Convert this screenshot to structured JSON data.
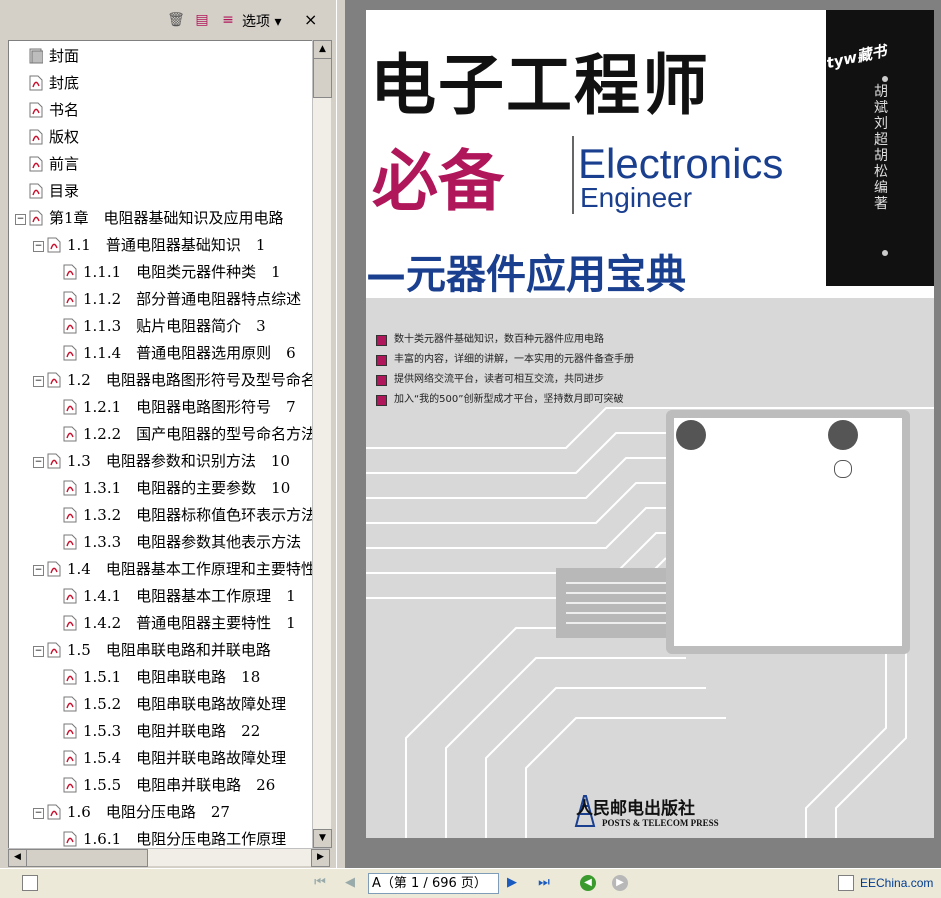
{
  "toolbar": {
    "options_label": "选项 ▾",
    "close_label": "×"
  },
  "bookmarks": [
    {
      "label": "封面",
      "level": 0,
      "expander": "",
      "icon": "page"
    },
    {
      "label": "封底",
      "level": 0,
      "expander": "",
      "icon": "pdf"
    },
    {
      "label": "书名",
      "level": 0,
      "expander": "",
      "icon": "pdf"
    },
    {
      "label": "版权",
      "level": 0,
      "expander": "",
      "icon": "pdf"
    },
    {
      "label": "前言",
      "level": 0,
      "expander": "",
      "icon": "pdf"
    },
    {
      "label": "目录",
      "level": 0,
      "expander": "",
      "icon": "pdf"
    },
    {
      "label": "第1章　电阻器基础知识及应用电路",
      "level": 0,
      "expander": "−",
      "icon": "pdf"
    },
    {
      "label": "1.1　普通电阻器基础知识　1",
      "level": 1,
      "expander": "−",
      "icon": "pdf"
    },
    {
      "label": "1.1.1　电阻类元器件种类　1",
      "level": 2,
      "expander": "",
      "icon": "pdf"
    },
    {
      "label": "1.1.2　部分普通电阻器特点综述",
      "level": 2,
      "expander": "",
      "icon": "pdf"
    },
    {
      "label": "1.1.3　贴片电阻器简介　3",
      "level": 2,
      "expander": "",
      "icon": "pdf"
    },
    {
      "label": "1.1.4　普通电阻器选用原则　6",
      "level": 2,
      "expander": "",
      "icon": "pdf"
    },
    {
      "label": "1.2　电阻器电路图形符号及型号命名",
      "level": 1,
      "expander": "−",
      "icon": "pdf"
    },
    {
      "label": "1.2.1　电阻器电路图形符号　7",
      "level": 2,
      "expander": "",
      "icon": "pdf"
    },
    {
      "label": "1.2.2　国产电阻器的型号命名方法",
      "level": 2,
      "expander": "",
      "icon": "pdf"
    },
    {
      "label": "1.3　电阻器参数和识别方法　10",
      "level": 1,
      "expander": "−",
      "icon": "pdf"
    },
    {
      "label": "1.3.1　电阻器的主要参数　10",
      "level": 2,
      "expander": "",
      "icon": "pdf"
    },
    {
      "label": "1.3.2　电阻器标称值色环表示方法",
      "level": 2,
      "expander": "",
      "icon": "pdf"
    },
    {
      "label": "1.3.3　电阻器参数其他表示方法",
      "level": 2,
      "expander": "",
      "icon": "pdf"
    },
    {
      "label": "1.4　电阻器基本工作原理和主要特性",
      "level": 1,
      "expander": "−",
      "icon": "pdf"
    },
    {
      "label": "1.4.1　电阻器基本工作原理　1",
      "level": 2,
      "expander": "",
      "icon": "pdf"
    },
    {
      "label": "1.4.2　普通电阻器主要特性　1",
      "level": 2,
      "expander": "",
      "icon": "pdf"
    },
    {
      "label": "1.5　电阻串联电路和并联电路",
      "level": 1,
      "expander": "−",
      "icon": "pdf"
    },
    {
      "label": "1.5.1　电阻串联电路　18",
      "level": 2,
      "expander": "",
      "icon": "pdf"
    },
    {
      "label": "1.5.2　电阻串联电路故障处理",
      "level": 2,
      "expander": "",
      "icon": "pdf"
    },
    {
      "label": "1.5.3　电阻并联电路　22",
      "level": 2,
      "expander": "",
      "icon": "pdf"
    },
    {
      "label": "1.5.4　电阻并联电路故障处理",
      "level": 2,
      "expander": "",
      "icon": "pdf"
    },
    {
      "label": "1.5.5　电阻串并联电路　26",
      "level": 2,
      "expander": "",
      "icon": "pdf"
    },
    {
      "label": "1.6　电阻分压电路　27",
      "level": 1,
      "expander": "−",
      "icon": "pdf"
    },
    {
      "label": "1.6.1　电阻分压电路工作原理",
      "level": 2,
      "expander": "",
      "icon": "pdf"
    }
  ],
  "cover": {
    "title_line1": "电子工程师",
    "title_line2": "必备",
    "title_en_line1": "Electronics",
    "title_en_line2": "Engineer",
    "subtitle": "—元器件应用宝典",
    "side_tag": "tyw藏书",
    "authors": "胡斌 刘超 胡松 编著",
    "bullets": [
      "数十类元器件基础知识，数百种元器件应用电路",
      "丰富的内容，详细的讲解，一本实用的元器件备查手册",
      "提供网络交流平台，读者可相互交流，共同进步",
      "加入“我的500”创新型成才平台，坚持数月即可突破"
    ],
    "publisher_cn": "人民邮电出版社",
    "publisher_en": "POSTS & TELECOM PRESS"
  },
  "statusbar": {
    "page_field": "A（第 1 / 696 页）",
    "watermark": "EEChina.com"
  },
  "colors": {
    "accent_magenta": "#b0165a",
    "accent_blue": "#1a3f8f"
  }
}
